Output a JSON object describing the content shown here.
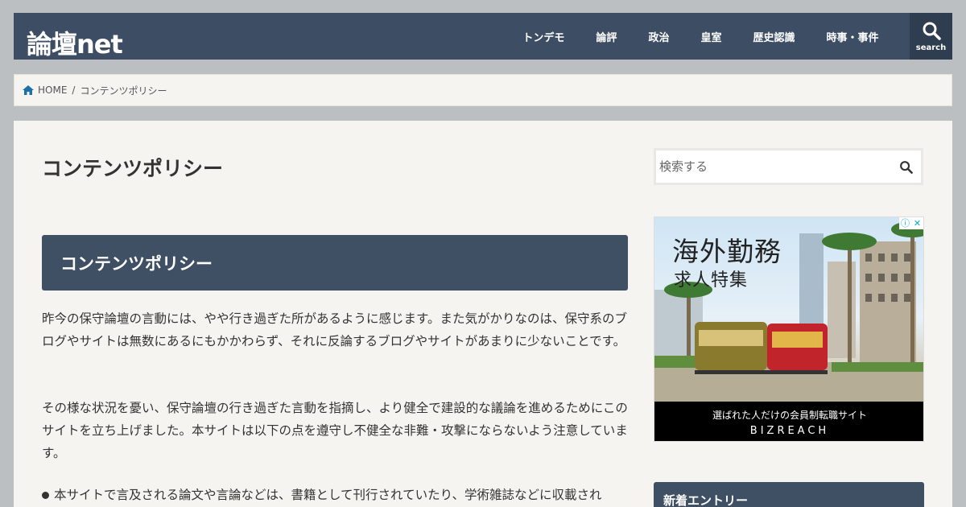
{
  "header": {
    "logo": "論壇net",
    "nav": [
      "トンデモ",
      "論評",
      "政治",
      "皇室",
      "歴史認識",
      "時事・事件"
    ],
    "search_label": "search"
  },
  "breadcrumb": {
    "home": "HOME",
    "separator": "/",
    "current": "コンテンツポリシー"
  },
  "main": {
    "title": "コンテンツポリシー",
    "section_heading": "コンテンツポリシー",
    "paragraph1": "昨今の保守論壇の言動には、やや行き過ぎた所があるように感じます。また気がかりなのは、保守系のブログやサイトは無数にあるにもかかわらず、それに反論するブログやサイトがあまりに少ないことです。",
    "paragraph2": "その様な状況を憂い、保守論壇の行き過ぎた言動を指摘し、より健全で建設的な議論を進めるためにこのサイトを立ち上げました。本サイトは以下の点を遵守し不健全な非難・攻撃にならないよう注意しています。",
    "bullet1": "本サイトで言及される論文や言論などは、書籍として刊行されていたり、学術雑誌などに収載され"
  },
  "sidebar": {
    "search_placeholder": "検索する",
    "ad": {
      "line1": "海外勤務",
      "line2": "求人特集",
      "tagline": "選ばれた人だけの会員制転職サイト",
      "brand": "BIZREACH"
    },
    "widget_title": "新着エントリー"
  },
  "colors": {
    "header_bg": "#3d4d63",
    "panel_bg": "#f5f4f0",
    "page_bg": "#bcbfc1"
  }
}
